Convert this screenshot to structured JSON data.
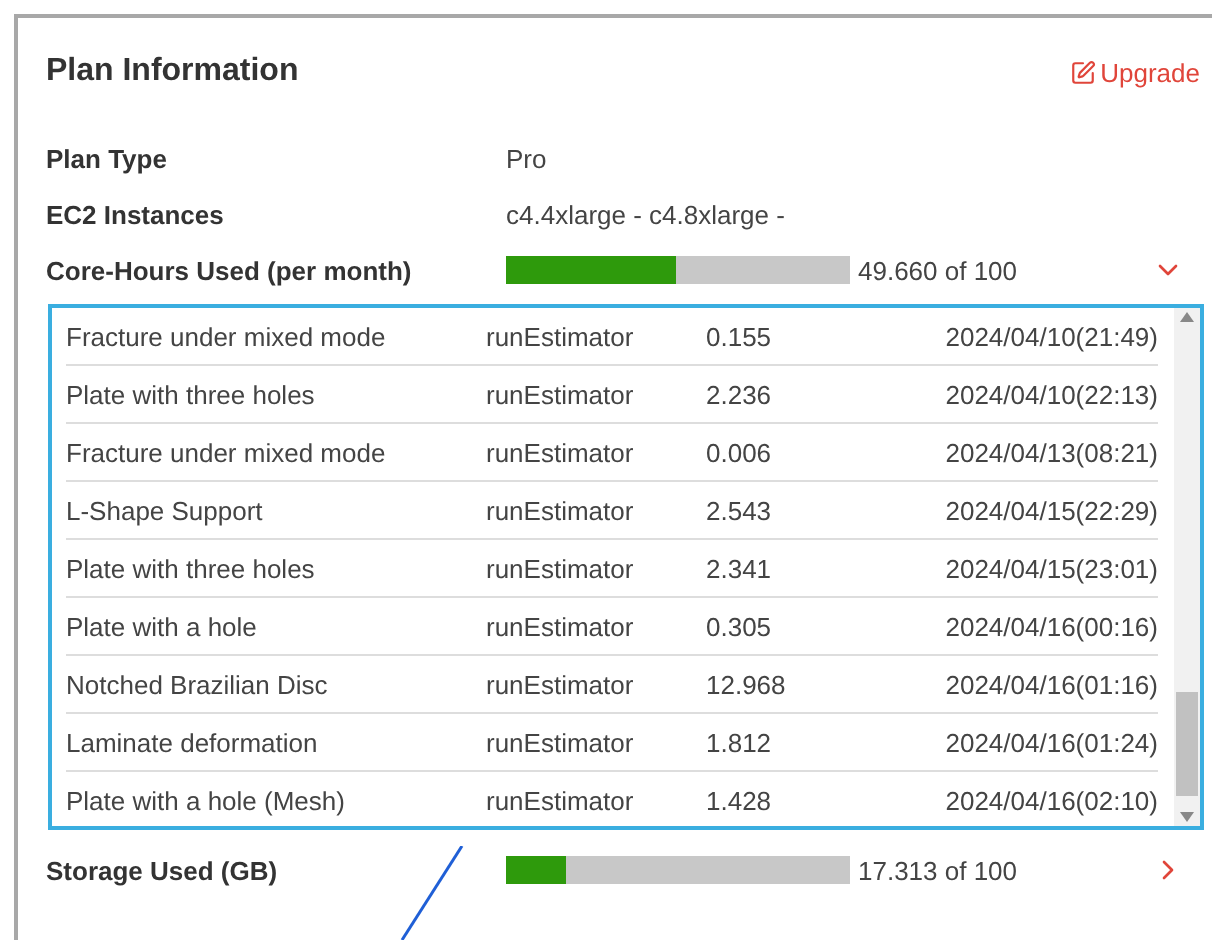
{
  "card": {
    "title": "Plan Information",
    "action": "Upgrade"
  },
  "info_rows": [
    {
      "label": "Plan Type",
      "value": "Pro"
    },
    {
      "label": "EC2 Instances",
      "value": "c4.4xlarge - c4.8xlarge -"
    }
  ],
  "usage_rows": [
    {
      "label": "Core-Hours Used (per month)",
      "level": 0.4966,
      "reading": "49.660 of 100",
      "expanded": true
    },
    {
      "label": "Storage Used (GB)",
      "level": 0.173,
      "reading": "17.313 of 100",
      "expanded": false
    }
  ],
  "table": {
    "rows": [
      [
        "Fracture under mixed mode",
        "runEstimator",
        "0.155",
        "2024/04/10(21:49)"
      ],
      [
        "Plate with three holes",
        "runEstimator",
        "2.236",
        "2024/04/10(22:13)"
      ],
      [
        "Fracture under mixed mode",
        "runEstimator",
        "0.006",
        "2024/04/13(08:21)"
      ],
      [
        "L-Shape Support",
        "runEstimator",
        "2.543",
        "2024/04/15(22:29)"
      ],
      [
        "Plate with three holes",
        "runEstimator",
        "2.341",
        "2024/04/15(23:01)"
      ],
      [
        "Plate with a hole",
        "runEstimator",
        "0.305",
        "2024/04/16(00:16)"
      ],
      [
        "Notched Brazilian Disc",
        "runEstimator",
        "12.968",
        "2024/04/16(01:16)"
      ],
      [
        "Laminate deformation",
        "runEstimator",
        "1.812",
        "2024/04/16(01:24)"
      ],
      [
        "Plate with a hole (Mesh)",
        "runEstimator",
        "1.428",
        "2024/04/16(02:10)"
      ]
    ]
  }
}
